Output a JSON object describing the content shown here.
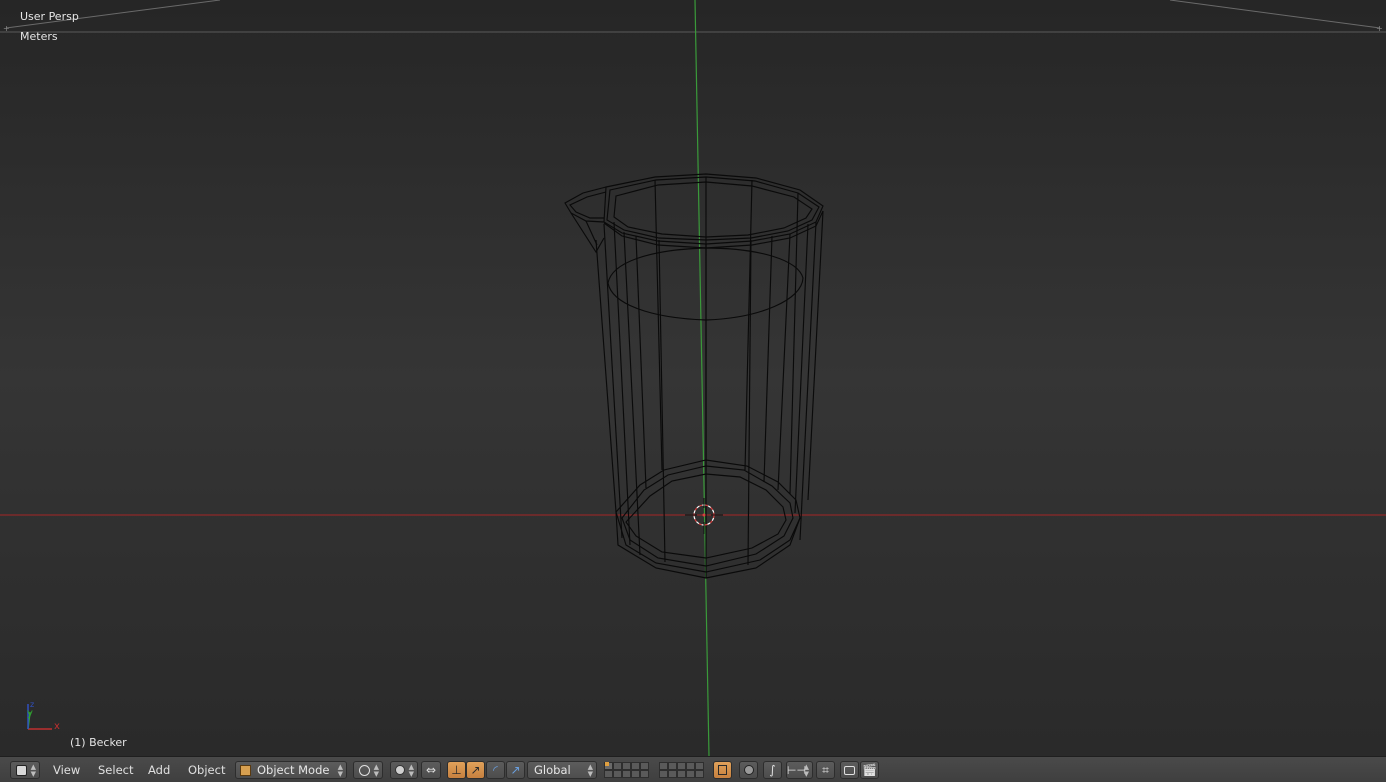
{
  "viewport": {
    "view_label": "User Persp",
    "units_label": "Meters",
    "object_label": "(1) Becker",
    "axis_gizmo": {
      "x": "x",
      "y": "y",
      "z": "z"
    },
    "colors": {
      "x_axis": "#a82a2a",
      "y_axis": "#2d9a2d",
      "wire": "#0a0a0a",
      "cursor": "#d84040"
    }
  },
  "header": {
    "editor_type_icon": "3d-view-icon",
    "menus": [
      "View",
      "Select",
      "Add",
      "Object"
    ],
    "mode": {
      "label": "Object Mode",
      "icon": "object-cube-icon"
    },
    "viewport_shading_icon": "shading-sphere-icon",
    "pivot_icon": "pivot-point-icon",
    "manipulator_icon": "manipulator-toggle-icon",
    "manipulators": [
      "translate-icon",
      "rotate-icon",
      "scale-icon"
    ],
    "orientation": "Global",
    "layers": 20,
    "extra_icons": [
      "lock-camera-icon",
      "proportional-edit-icon",
      "falloff-icon",
      "snap-icon",
      "snap-target-icon",
      "opengl-render-icon",
      "opengl-anim-icon"
    ],
    "accent": "#d08c4a"
  }
}
